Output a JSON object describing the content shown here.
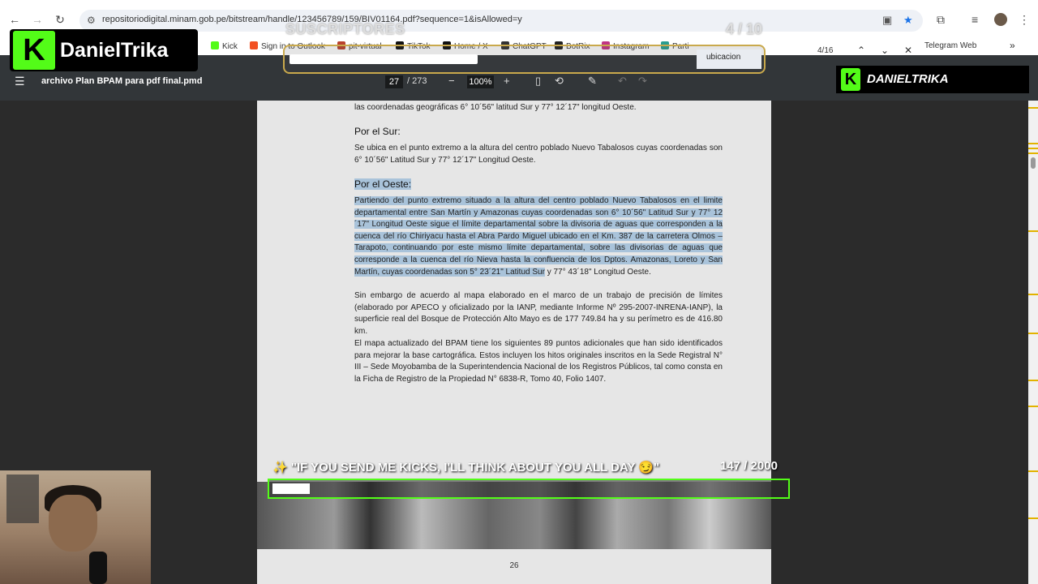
{
  "browser": {
    "url": "repositoriodigital.minam.gob.pe/bitstream/handle/123456789/159/BIV01164.pdf?sequence=1&isAllowed=y",
    "bookmarks": [
      "Kick",
      "Sign in to Outlook",
      "pit-virtual",
      "TikTok",
      "Home / X",
      "ChatGPT",
      "BotRix",
      "Instagram",
      "Parti",
      "Telegram Web"
    ],
    "bookmark_colors": [
      "#53fc18",
      "#f25022",
      "#b9412d",
      "#111111",
      "#111111",
      "#333333",
      "#222222",
      "#c13584",
      "#2a9d8f",
      "#229ed9"
    ]
  },
  "pdf_toolbar": {
    "title": "archivo Plan BPAM para pdf final.pmd",
    "page_current": "27",
    "page_total": "/ 273",
    "zoom": "100%"
  },
  "find_bar": {
    "query": "ubicacion",
    "count": "4/16"
  },
  "overlay": {
    "subs_label": "SUSCRIPTORES",
    "subs_count": "4 / 10",
    "subs_progress": 0.4,
    "brand_name_left": "DanielTrika",
    "brand_name_right": "DANIELTRIKA",
    "goal_text": "✨ \"IF YOU SEND ME KICKS, I'LL THINK ABOUT YOU ALL DAY 😏\"",
    "goal_current": "147",
    "goal_total": "/ 2000",
    "goal_progress": 0.0735,
    "accent_color": "#53fc18"
  },
  "document": {
    "line_top": "las coordenadas geográficas 6° 10´56\" latitud Sur y 77° 12´17\" longitud Oeste.",
    "heading_sur": "Por el Sur:",
    "para_sur": "Se ubica en el punto extremo a la altura del centro poblado Nuevo Tabalosos cuyas coordenadas son 6° 10´56\" Latitud Sur y 77° 12´17\" Longitud Oeste.",
    "heading_oeste": "Por el Oeste:",
    "para_oeste_selected": "Partiendo del punto extremo situado a la altura del centro poblado Nuevo Tabalosos en el limite departamental entre San Martín y Amazonas cuyas coordenadas son 6° 10´56\" Latitud Sur y 77° 12´17\" Longitud Oeste sigue el límite departamental sobre la divisoria de aguas que corresponden a la cuenca del río Chiriyacu hasta el Abra Pardo Miguel ubicado en el Km. 387 de la carretera Olmos – Tarapoto, continuando por este mismo límite departamental, sobre las divisorias de aguas que corresponde a la cuenca del río Nieva hasta la confluencia de los Dptos. Amazonas, Loreto y San Martín, cuyas coordenadas son 5° 23´21\" Latitud Sur",
    "para_oeste_rest": " y 77° 43´18\" Longitud Oeste.",
    "para_embargo": "Sin embargo de acuerdo al mapa elaborado en el marco de un trabajo de precisión de límites (elaborado por APECO y oficializado por la IANP, mediante  Informe Nº 295-2007-INRENA-IANP), la superficie real del Bosque de Protección Alto Mayo es de  177 749.84 ha y su perímetro es de 416.80 km.",
    "para_mapa": "El mapa actualizado del BPAM tiene los siguientes 89 puntos adicionales que han sido identificados para mejorar la base cartográfica. Estos incluyen los hitos originales inscritos en la Sede Registral N° III – Sede Moyobamba de la Superintendencia Nacional de los Registros Públicos, tal como consta en la Ficha de Registro de la Propiedad N° 6838-R, Tomo 40, Folio 1407.",
    "page_number": "26"
  }
}
